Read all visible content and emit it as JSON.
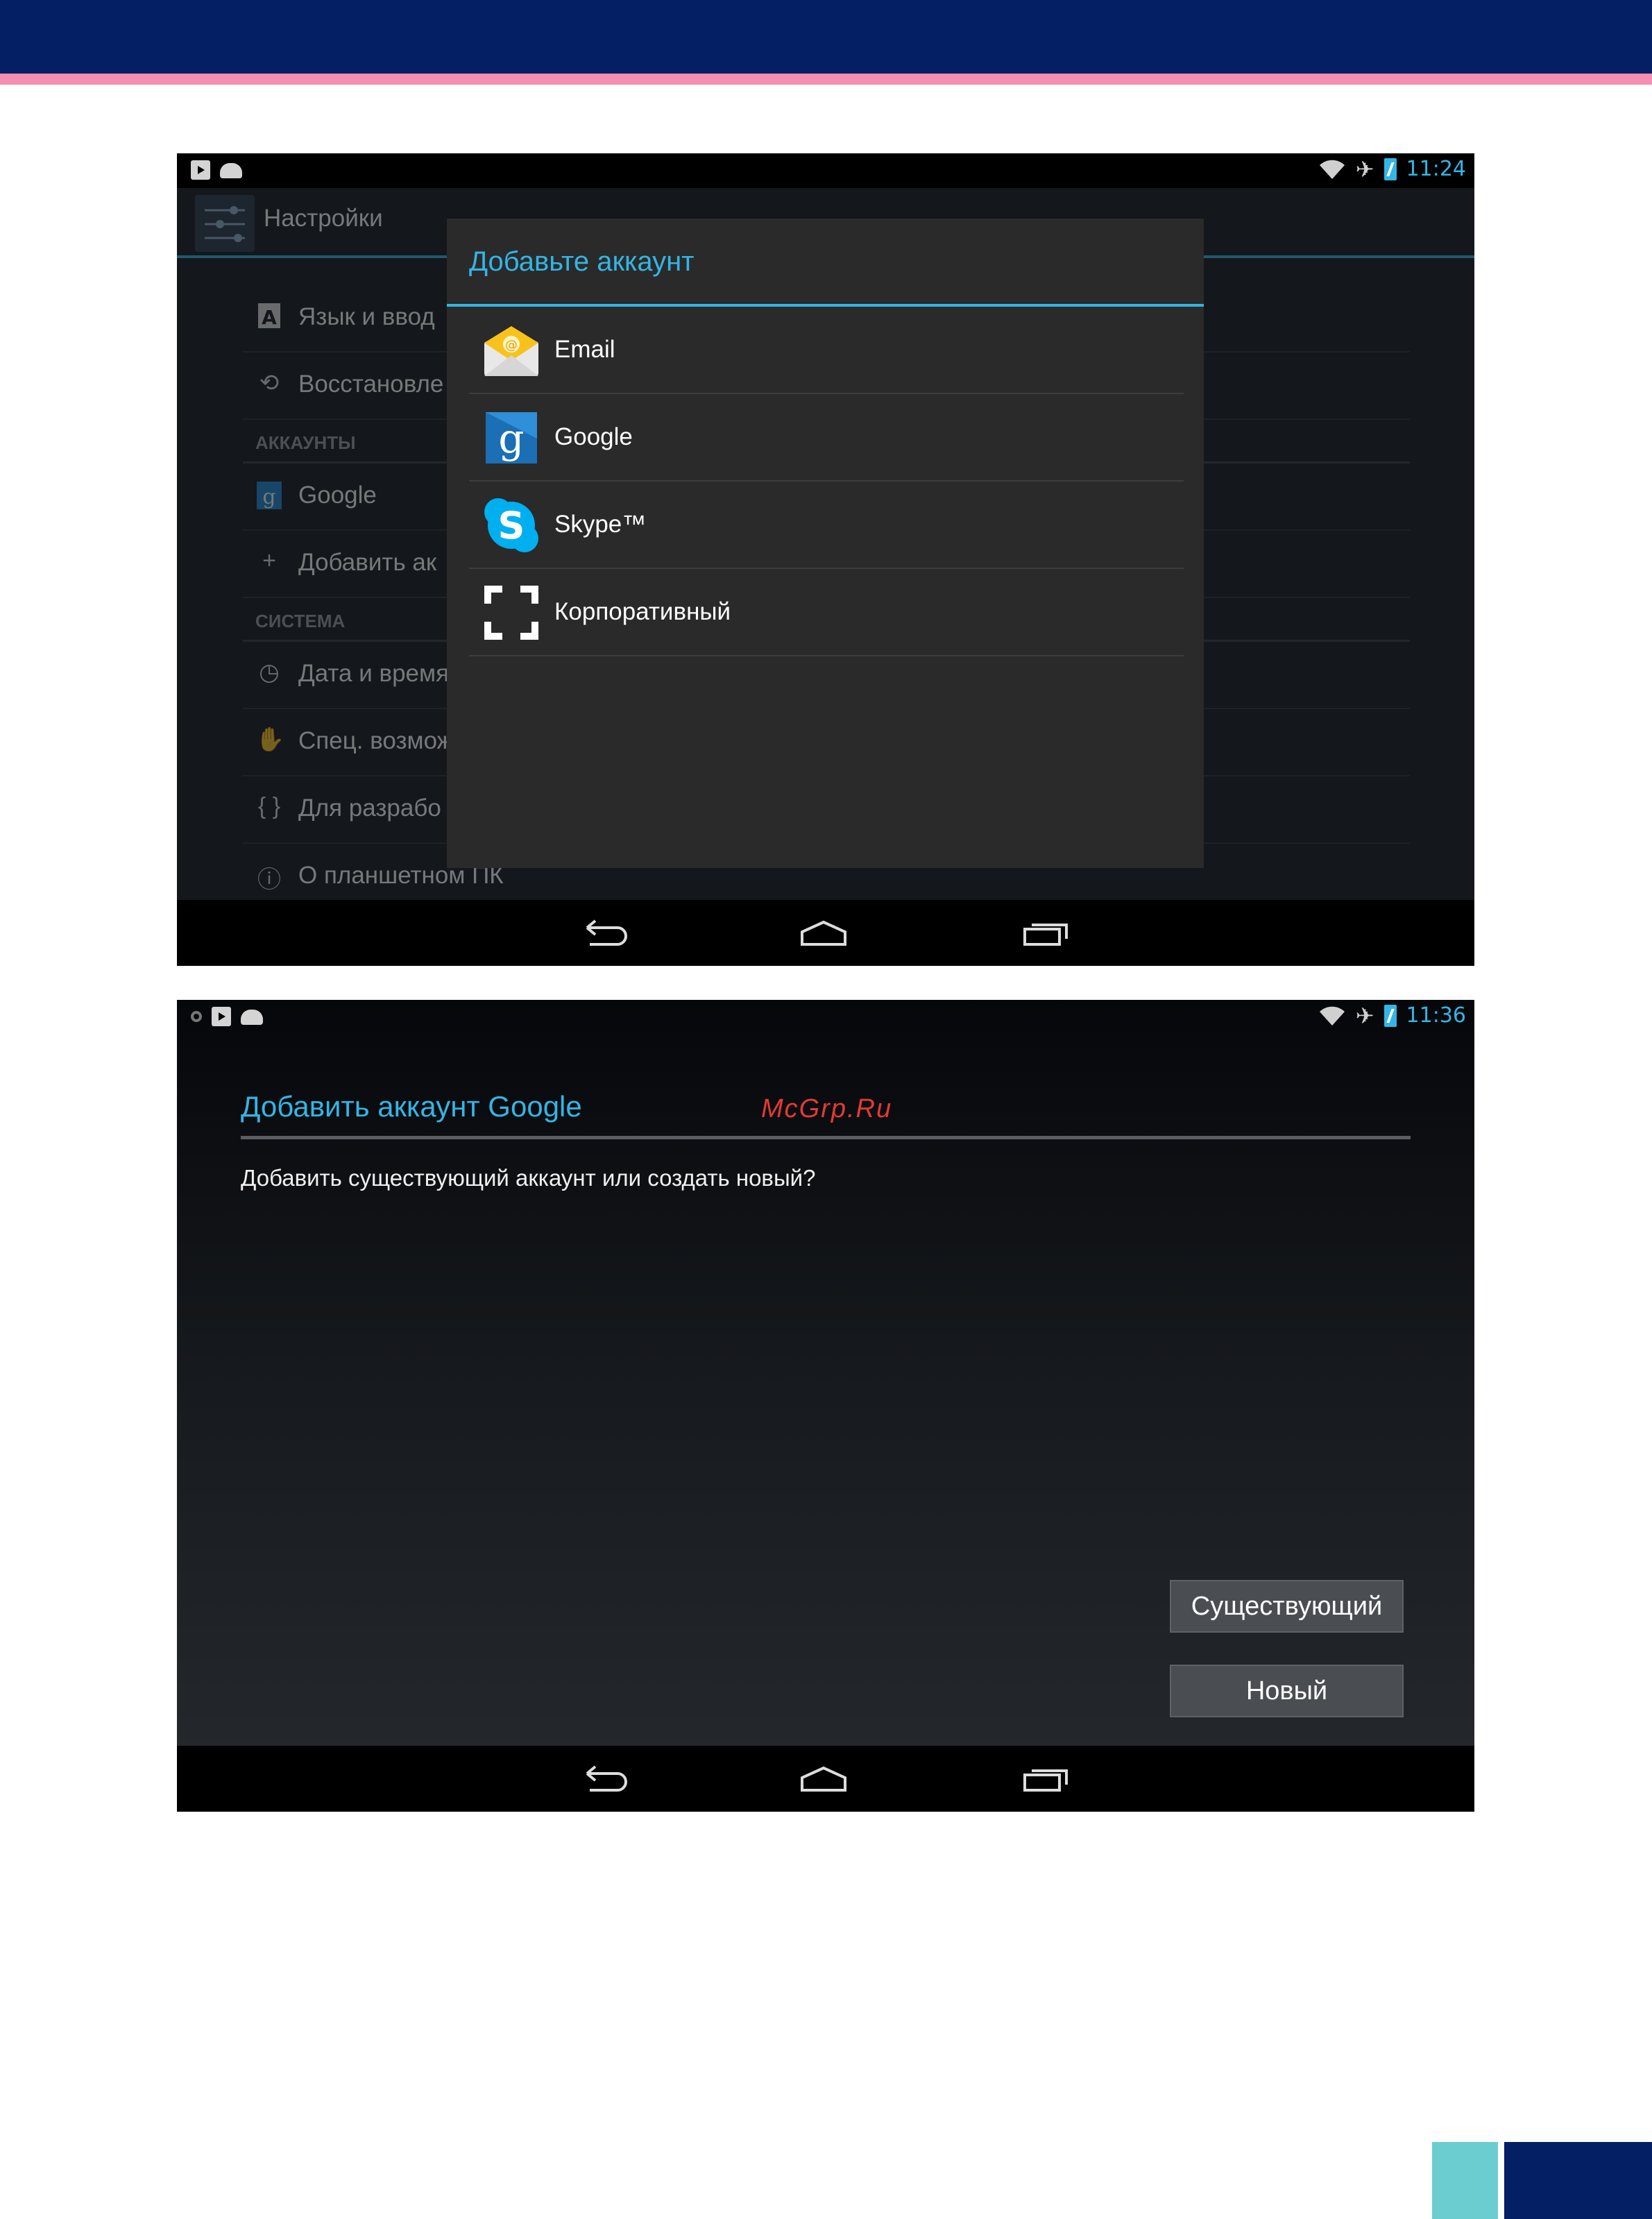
{
  "colors": {
    "header": "#051f64",
    "stripe": "#f48fb1",
    "accent": "#33b5e5",
    "watermark": "#e53935",
    "corner_teal": "#6ccdd1"
  },
  "screen1": {
    "status_time": "11:24",
    "settings_title": "Настройки",
    "settings_rows": [
      {
        "kind": "item",
        "icon": "language-icon",
        "label": "Язык и ввод"
      },
      {
        "kind": "item",
        "icon": "restore-icon",
        "label": "Восстановле"
      },
      {
        "kind": "header",
        "label": "АККАУНТЫ"
      },
      {
        "kind": "item",
        "icon": "google-icon",
        "label": "Google"
      },
      {
        "kind": "item",
        "icon": "plus-icon",
        "label": "Добавить ак"
      },
      {
        "kind": "header",
        "label": "СИСТЕМА"
      },
      {
        "kind": "item",
        "icon": "clock-icon",
        "label": "Дата и время"
      },
      {
        "kind": "item",
        "icon": "hand-icon",
        "label": "Спец. возмож"
      },
      {
        "kind": "item",
        "icon": "braces-icon",
        "label": "Для разрабо"
      },
      {
        "kind": "item",
        "icon": "info-icon",
        "label": "О планшетном ПК"
      }
    ],
    "dialog": {
      "title": "Добавьте аккаунт",
      "items": [
        {
          "icon": "email-icon",
          "label": "Email"
        },
        {
          "icon": "google-icon",
          "label": "Google"
        },
        {
          "icon": "skype-icon",
          "label": "Skype™"
        },
        {
          "icon": "corporate-icon",
          "label": "Корпоративный"
        }
      ]
    }
  },
  "screen2": {
    "status_time": "11:36",
    "title": "Добавить аккаунт Google",
    "watermark": "McGrp.Ru",
    "question": "Добавить существующий аккаунт или создать новый?",
    "buttons": {
      "existing": "Существующий",
      "new": "Новый"
    }
  }
}
